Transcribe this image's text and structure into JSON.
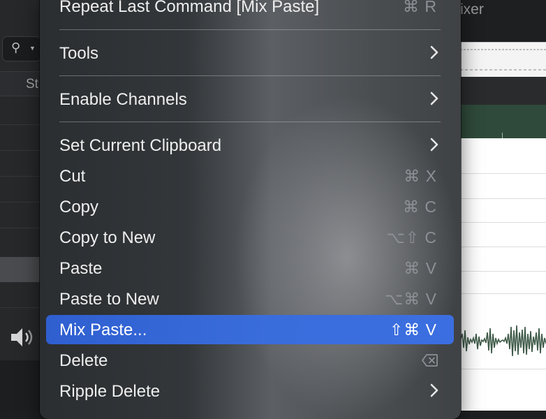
{
  "background": {
    "column_header": "St",
    "mixer_tab": "ixer"
  },
  "menu": {
    "items": [
      {
        "label": "Repeat Last Command [Mix Paste]",
        "shortcut": "⌘ R"
      },
      {
        "label": "Tools",
        "submenu": true
      },
      {
        "label": "Enable Channels",
        "submenu": true
      },
      {
        "label": "Set Current Clipboard",
        "submenu": true
      },
      {
        "label": "Cut",
        "shortcut": "⌘ X"
      },
      {
        "label": "Copy",
        "shortcut": "⌘ C"
      },
      {
        "label": "Copy to New",
        "shortcut": "⌥⇧ C"
      },
      {
        "label": "Paste",
        "shortcut": "⌘ V"
      },
      {
        "label": "Paste to New",
        "shortcut": "⌥⌘ V"
      },
      {
        "label": "Mix Paste...",
        "shortcut": "⇧⌘ V",
        "highlighted": true
      },
      {
        "label": "Delete",
        "icon": "delete-key-icon"
      },
      {
        "label": "Ripple Delete",
        "submenu": true
      }
    ]
  },
  "colors": {
    "highlight": "#3a6ddc",
    "menu_text": "#eeeeee",
    "shortcut_text": "#8d9094"
  }
}
